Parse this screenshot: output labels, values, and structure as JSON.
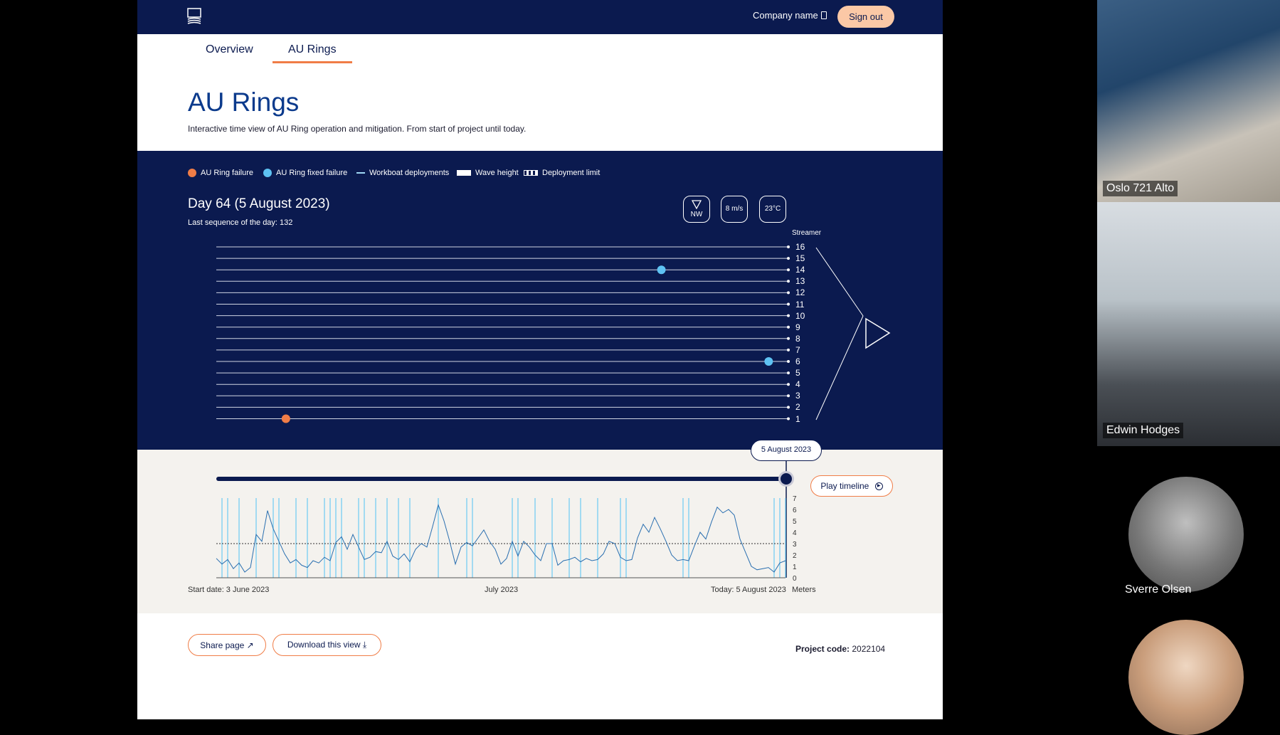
{
  "header": {
    "company": "Company name",
    "signout_label": "Sign out"
  },
  "tabs": [
    {
      "label": "Overview",
      "active": false
    },
    {
      "label": "AU Rings",
      "active": true
    }
  ],
  "page": {
    "title": "AU Rings",
    "subtitle": "Interactive time view of AU Ring operation and mitigation. From start of project until today."
  },
  "legend": {
    "failure": "AU Ring failure",
    "fixed": "AU Ring fixed failure",
    "workboat": "Workboat deployments",
    "wave": "Wave height",
    "limit": "Deployment limit"
  },
  "day": {
    "title": "Day 64 (5 August 2023)",
    "sequence": "Last sequence of the day: 132",
    "wind_dir": "NW",
    "wind_speed": "8 m/s",
    "temp": "23°C"
  },
  "streamer_label": "Streamer",
  "streamers": [
    16,
    15,
    14,
    13,
    12,
    11,
    10,
    9,
    8,
    7,
    6,
    5,
    4,
    3,
    2,
    1
  ],
  "events": [
    {
      "streamer": 14,
      "type": "fixed",
      "position": 0.78
    },
    {
      "streamer": 6,
      "type": "fixed",
      "position": 0.968
    },
    {
      "streamer": 1,
      "type": "failure",
      "position": 0.122
    }
  ],
  "timeline": {
    "current_date": "5 August 2023",
    "play_label": "Play timeline",
    "start_label": "Start date: 3 June 2023",
    "mid_label": "July 2023",
    "end_label": "Today: 5 August 2023",
    "units_label": "Meters",
    "progress": 1.0
  },
  "chart_data": {
    "type": "line",
    "xlabel": "",
    "ylabel": "Meters",
    "ylim": [
      0,
      7
    ],
    "y_ticks": [
      0,
      1,
      2,
      3,
      4,
      5,
      6,
      7
    ],
    "deployment_limit": 3,
    "wave_height": [
      1.7,
      1.2,
      1.6,
      0.8,
      1.3,
      0.5,
      0.9,
      3.8,
      3.2,
      5.9,
      4.3,
      3.2,
      2.1,
      1.3,
      1.6,
      1.1,
      0.9,
      1.5,
      1.3,
      1.8,
      1.5,
      3.1,
      3.6,
      2.5,
      3.8,
      2.7,
      1.6,
      1.8,
      2.3,
      2.2,
      3.2,
      1.9,
      1.6,
      2.1,
      1.4,
      2.5,
      3.0,
      2.7,
      4.5,
      6.4,
      5.0,
      3.2,
      1.2,
      2.7,
      3.1,
      2.8,
      3.5,
      4.2,
      3.2,
      2.5,
      1.2,
      1.7,
      3.2,
      1.9,
      3.2,
      2.7,
      2.0,
      1.5,
      3.0,
      3.0,
      1.1,
      1.5,
      1.6,
      1.8,
      1.4,
      1.7,
      1.5,
      1.6,
      2.1,
      3.2,
      3.0,
      1.8,
      1.5,
      1.6,
      3.5,
      4.7,
      4.0,
      5.3,
      4.3,
      3.2,
      2.0,
      1.5,
      1.6,
      1.5,
      2.8,
      4.0,
      3.4,
      4.9,
      6.2,
      5.7,
      6.0,
      5.5,
      3.4,
      2.2,
      1.0,
      0.7,
      0.8,
      0.9,
      0.5,
      1.3,
      1.5
    ],
    "workboat_deployments": [
      1,
      2,
      4,
      7,
      10,
      11,
      14,
      16,
      19,
      20,
      21,
      22,
      25,
      26,
      28,
      30,
      32,
      34,
      39,
      44,
      45,
      52,
      53,
      56,
      59,
      62,
      64,
      67,
      71,
      72,
      82,
      83,
      98,
      99,
      100
    ],
    "wave_units": "Meters"
  },
  "footer": {
    "share_label": "Share page",
    "download_label": "Download this view",
    "project_key": "Project code:",
    "project_value": "2022104"
  },
  "participants": {
    "room": "Oslo 721 Alto",
    "p2": "Edwin Hodges",
    "p3": "Sverre Olsen"
  },
  "colors": {
    "navy": "#0b1a4f",
    "orange": "#f07d47",
    "light_blue": "#5ec2f2",
    "peach": "#fbc8a6"
  }
}
